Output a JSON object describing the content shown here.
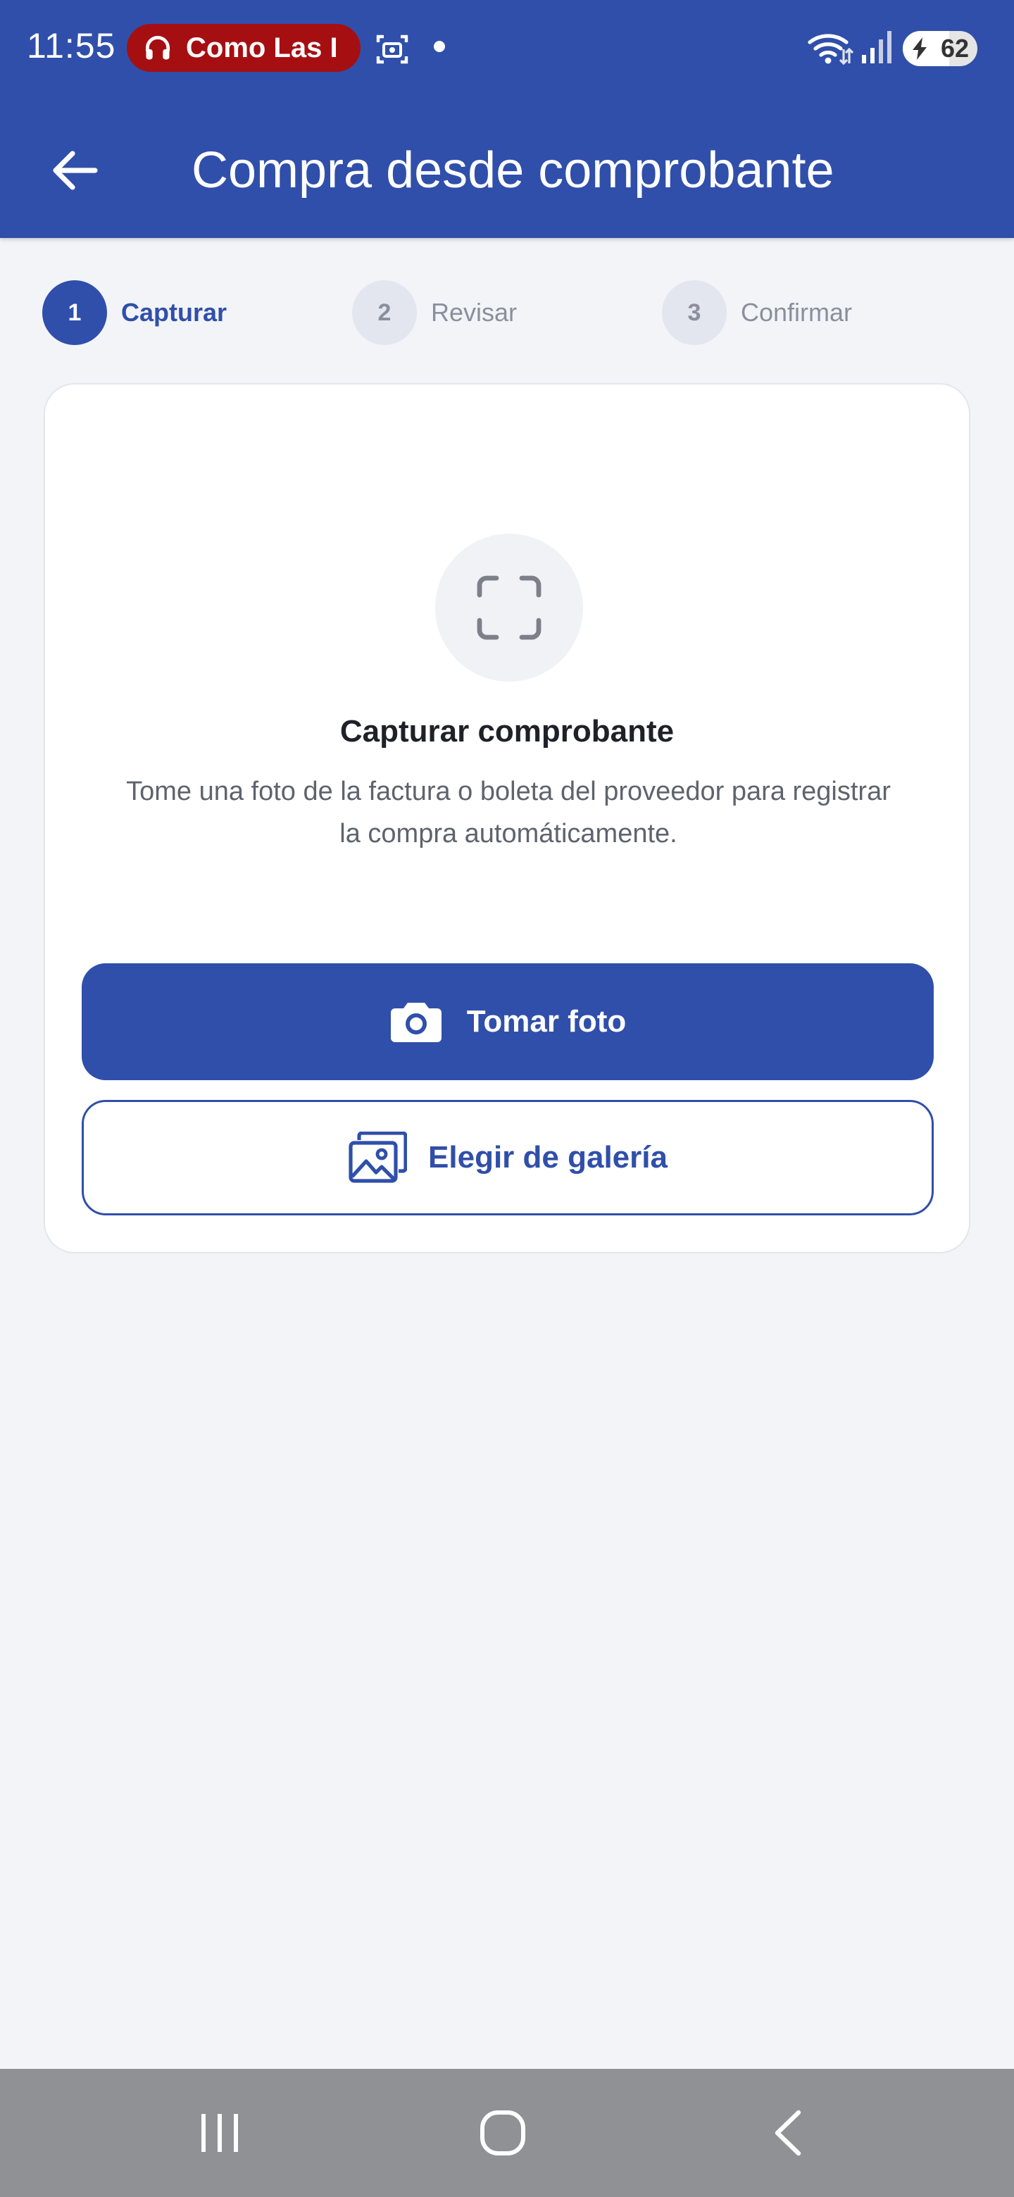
{
  "status_bar": {
    "time": "11:55",
    "media_text": "Como Las I",
    "battery_percent": "62",
    "battery_level": 0.62,
    "icons": [
      "headphones-icon",
      "screenshot-icon",
      "notification-dot-icon",
      "wifi-icon",
      "cell-signal-icon",
      "battery-charging-icon"
    ]
  },
  "app_bar": {
    "title": "Compra desde comprobante",
    "back_icon": "arrow-left-icon"
  },
  "stepper": {
    "active_index": 0,
    "steps": [
      {
        "number": "1",
        "label": "Capturar"
      },
      {
        "number": "2",
        "label": "Revisar"
      },
      {
        "number": "3",
        "label": "Confirmar"
      }
    ]
  },
  "card": {
    "icon": "scan-frame-icon",
    "title": "Capturar comprobante",
    "description": "Tome una foto de la factura o boleta del proveedor para registrar la compra automáticamente.",
    "primary_button": {
      "label": "Tomar foto",
      "icon": "camera-icon"
    },
    "secondary_button": {
      "label": "Elegir de galería",
      "icon": "gallery-icon"
    }
  },
  "nav_bar": {
    "icons": [
      "recent-apps-icon",
      "home-icon",
      "back-icon"
    ]
  },
  "colors": {
    "primary": "#304faa",
    "background": "#f2f4f8",
    "media_pill": "#a60f12",
    "nav_bar": "#8f9194"
  }
}
